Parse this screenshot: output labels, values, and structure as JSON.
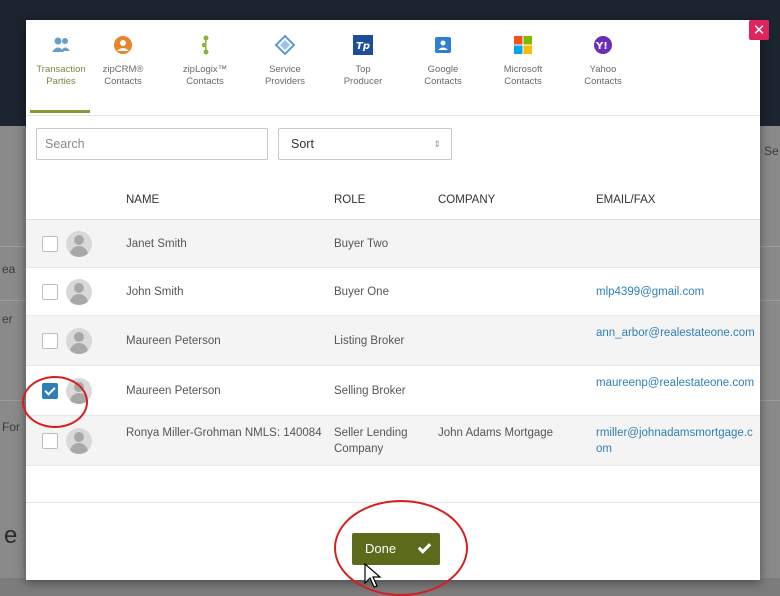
{
  "background": {
    "fragments": [
      "ea",
      "er",
      "For",
      "Se",
      "e"
    ]
  },
  "modal": {
    "close_glyph": "✕",
    "tabs": [
      {
        "id": "transaction-parties",
        "label": "Transaction\nParties",
        "icon": "people-icon",
        "color": "#6b9ec7"
      },
      {
        "id": "zipcrm",
        "label": "zipCRM®\nContacts",
        "icon": "zipcrm-icon",
        "color": "#e8852a"
      },
      {
        "id": "ziplogix",
        "label": "zipLogix™\nContacts",
        "icon": "ziplogix-icon",
        "color": "#8bb23c"
      },
      {
        "id": "service-providers",
        "label": "Service\nProviders",
        "icon": "diamond-icon",
        "color": "#5e9ad8"
      },
      {
        "id": "top-producer",
        "label": "Top\nProducer",
        "icon": "top-producer-icon",
        "color": "#1d4e9b"
      },
      {
        "id": "google",
        "label": "Google\nContacts",
        "icon": "google-contacts-icon",
        "color": "#2f7fd0"
      },
      {
        "id": "microsoft",
        "label": "Microsoft\nContacts",
        "icon": "microsoft-icon",
        "color": "#e04a2a"
      },
      {
        "id": "yahoo",
        "label": "Yahoo\nContacts",
        "icon": "yahoo-icon",
        "color": "#6c2db8"
      }
    ],
    "tp_glyph": "Tp",
    "yahoo_glyph": "Y!",
    "search_placeholder": "Search",
    "sort_label": "Sort",
    "sort_arrows": "⇕",
    "columns": {
      "name": "NAME",
      "role": "ROLE",
      "company": "COMPANY",
      "email": "EMAIL/FAX"
    },
    "rows": [
      {
        "name": "Janet Smith",
        "role": "Buyer Two",
        "company": "",
        "email": "",
        "checked": false
      },
      {
        "name": "John Smith",
        "role": "Buyer One",
        "company": "",
        "email": "mlp4399@gmail.com",
        "checked": false
      },
      {
        "name": "Maureen Peterson",
        "role": "Listing Broker",
        "company": "",
        "email": "ann_arbor@realestateone.com",
        "checked": false
      },
      {
        "name": "Maureen Peterson",
        "role": "Selling Broker",
        "company": "",
        "email": "maureenp@realestateone.com",
        "checked": true
      },
      {
        "name": "Ronya Miller-Grohman NMLS: 140084",
        "role": "Seller Lending Company",
        "company": "John Adams Mortgage",
        "email": "rmiller@johnadamsmortgage.com",
        "checked": false
      }
    ],
    "done_label": "Done"
  }
}
